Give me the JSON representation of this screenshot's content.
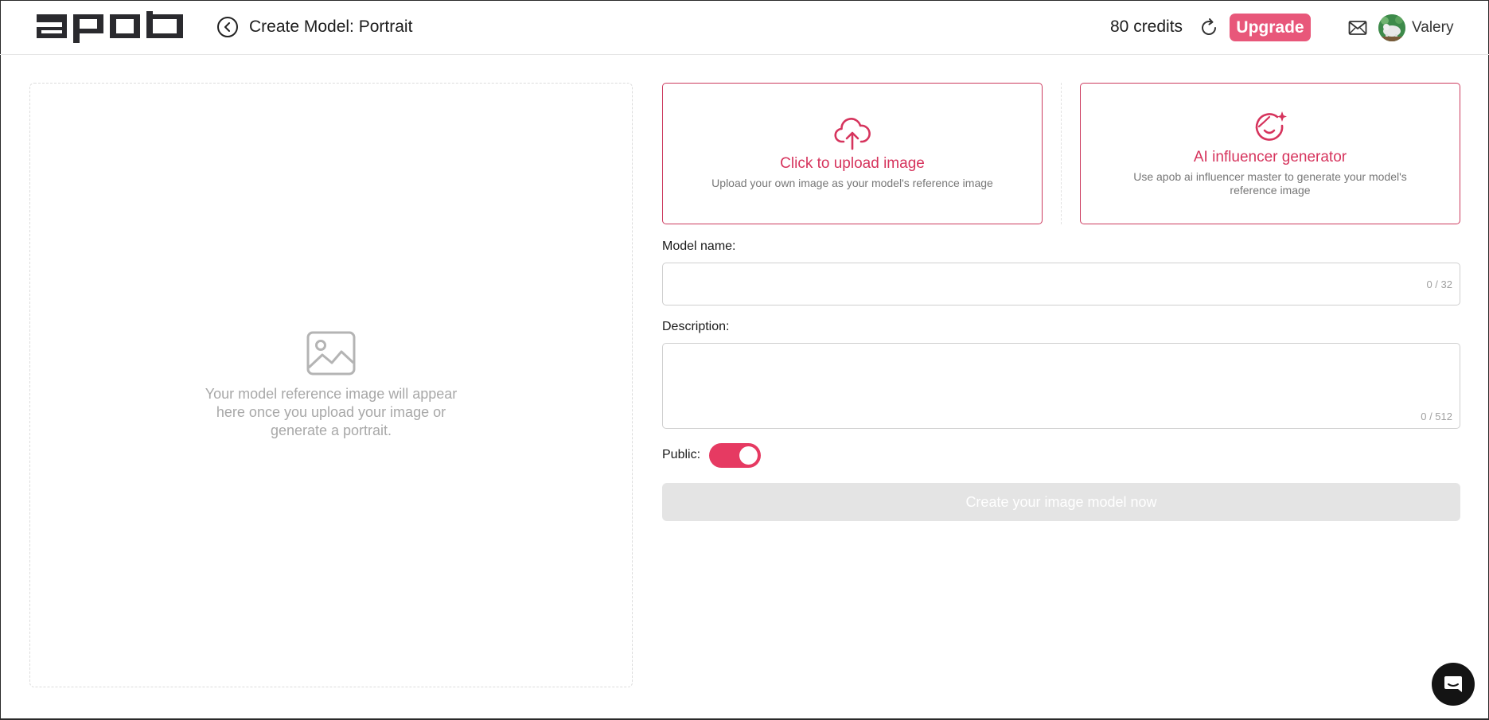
{
  "header": {
    "logo_text": "apob",
    "page_title": "Create Model: Portrait",
    "credits": "80 credits",
    "upgrade_label": "Upgrade",
    "user_name": "Valery"
  },
  "preview": {
    "placeholder": "Your model reference image will appear here once you upload your image or generate a portrait."
  },
  "options": {
    "upload": {
      "title": "Click to upload image",
      "subtitle": "Upload your own image as your model's reference image"
    },
    "ai": {
      "title": "AI influencer generator",
      "subtitle": "Use apob ai influencer master to generate your model's reference image"
    }
  },
  "form": {
    "model_name_label": "Model name:",
    "model_name_value": "",
    "model_name_counter": "0 / 32",
    "description_label": "Description:",
    "description_value": "",
    "description_counter": "0 / 512",
    "public_label": "Public:",
    "public_on": true,
    "submit_label": "Create your image model now"
  },
  "icons": {
    "back": "chevron-left-icon",
    "refresh": "refresh-icon",
    "mail": "mail-icon",
    "upload": "cloud-upload-icon",
    "ai": "face-sparkle-icon",
    "image": "image-placeholder-icon",
    "chat": "chat-icon"
  },
  "colors": {
    "accent": "#e63a62",
    "upgrade": "#e8577a",
    "card_border": "#cc3a5e",
    "disabled": "#e4e4e4"
  }
}
